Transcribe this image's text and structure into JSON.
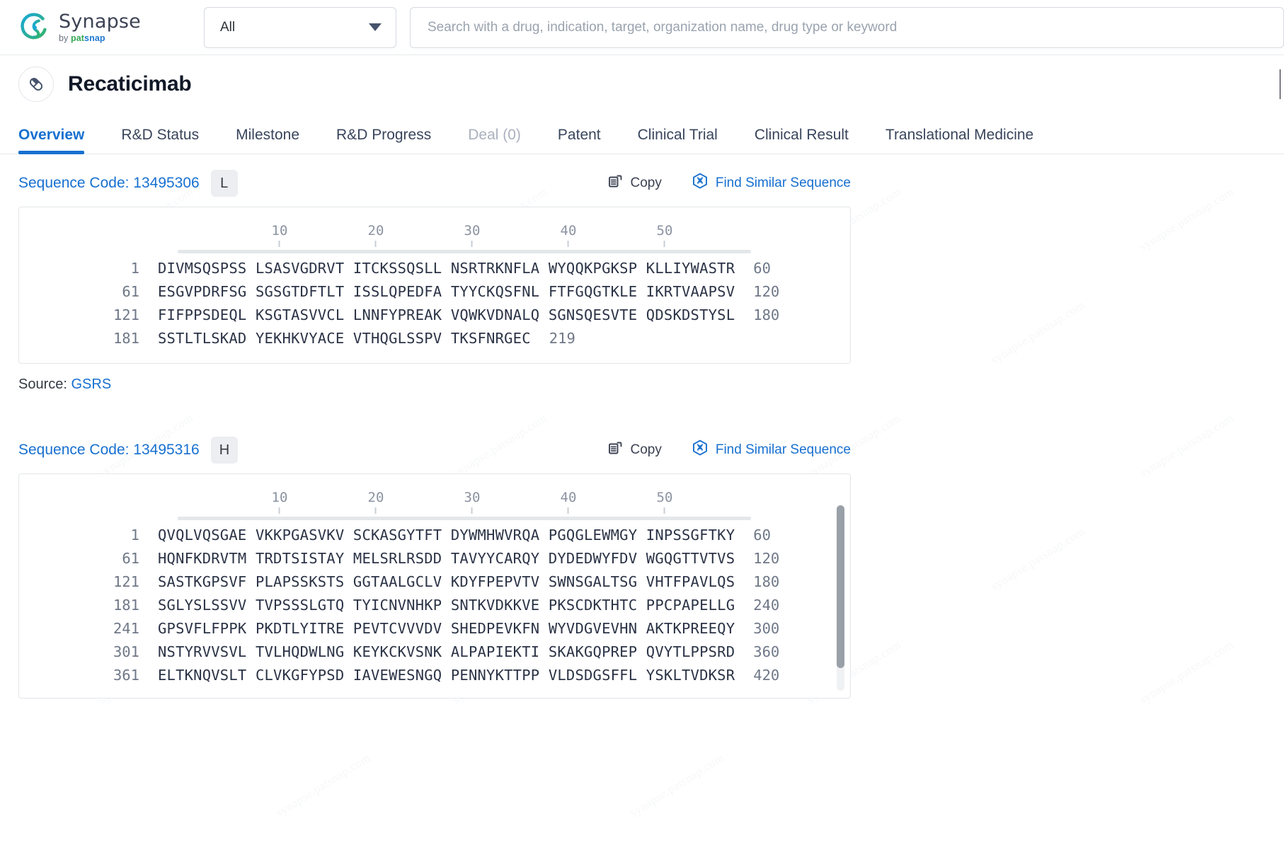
{
  "brand": {
    "name": "Synapse",
    "by": "by ",
    "pat": "pat",
    "snap": "snap",
    "logo_icon": "synapse-logo-icon"
  },
  "search": {
    "scope_value": "All",
    "scope_caret_icon": "chevron-down-icon",
    "placeholder": "Search with a drug, indication, target, organization name, drug type or keyword",
    "value": ""
  },
  "drug": {
    "avatar_icon": "pill-icon",
    "name": "Recaticimab"
  },
  "tabs": [
    {
      "label": "Overview",
      "state": "active"
    },
    {
      "label": "R&D Status",
      "state": "normal"
    },
    {
      "label": "Milestone",
      "state": "normal"
    },
    {
      "label": "R&D Progress",
      "state": "normal"
    },
    {
      "label": "Deal (0)",
      "state": "disabled"
    },
    {
      "label": "Patent",
      "state": "normal"
    },
    {
      "label": "Clinical Trial",
      "state": "normal"
    },
    {
      "label": "Clinical Result",
      "state": "normal"
    },
    {
      "label": "Translational Medicine",
      "state": "normal"
    }
  ],
  "actions": {
    "copy_label": "Copy",
    "copy_icon": "copy-icon",
    "find_label": "Find Similar Sequence",
    "find_icon": "dna-hexagon-icon"
  },
  "ruler": {
    "ticks": [
      "10",
      "20",
      "30",
      "40",
      "50"
    ]
  },
  "source": {
    "label": "Source:",
    "link": "GSRS"
  },
  "sequences": [
    {
      "code_label": "Sequence Code: 13495306",
      "chain": "L",
      "rows": [
        {
          "start": "1",
          "seq": "DIVMSQSPSS LSASVGDRVT ITCKSSQSLL NSRTRKNFLA WYQQKPGKSP KLLIYWASTR",
          "end": "60"
        },
        {
          "start": "61",
          "seq": "ESGVPDRFSG SGSGTDFTLT ISSLQPEDFA TYYCKQSFNL FTFGQGTKLE IKRTVAAPSV",
          "end": "120"
        },
        {
          "start": "121",
          "seq": "FIFPPSDEQL KSGTASVVCL LNNFYPREAK VQWKVDNALQ SGNSQESVTE QDSKDSTYSL",
          "end": "180"
        },
        {
          "start": "181",
          "seq": "SSTLTLSKAD YEKHKVYACE VTHQGLSSPV TKSFNRGEC",
          "end": "219"
        }
      ]
    },
    {
      "code_label": "Sequence Code: 13495316",
      "chain": "H",
      "rows": [
        {
          "start": "1",
          "seq": "QVQLVQSGAE VKKPGASVKV SCKASGYTFT DYWMHWVRQA PGQGLEWMGY INPSSGFTKY",
          "end": "60"
        },
        {
          "start": "61",
          "seq": "HQNFKDRVTM TRDTSISTAY MELSRLRSDD TAVYYCARQY DYDEDWYFDV WGQGTTVTVS",
          "end": "120"
        },
        {
          "start": "121",
          "seq": "SASTKGPSVF PLAPSSKSTS GGTAALGCLV KDYFPEPVTV SWNSGALTSG VHTFPAVLQS",
          "end": "180"
        },
        {
          "start": "181",
          "seq": "SGLYSLSSVV TVPSSSLGTQ TYICNVNHKP SNTKVDKKVE PKSCDKTHTC PPCPAPELLG",
          "end": "240"
        },
        {
          "start": "241",
          "seq": "GPSVFLFPPK PKDTLYITRE PEVTCVVVDV SHEDPEVKFN WYVDGVEVHN AKTKPREEQY",
          "end": "300"
        },
        {
          "start": "301",
          "seq": "NSTYRVVSVL TVLHQDWLNG KEYKCKVSNK ALPAPIEKTI SKAKGQPREP QVYTLPPSRD",
          "end": "360"
        },
        {
          "start": "361",
          "seq": "ELTKNQVSLT CLVKGFYPSD IAVEWESNGQ PENNYKTTPP VLDSDGSFFL YSKLTVDKSR",
          "end": "420"
        }
      ]
    }
  ],
  "colors": {
    "accent": "#1770d0",
    "text": "#2b3346",
    "muted": "#6f7887",
    "badge_bg": "#eceef1"
  }
}
